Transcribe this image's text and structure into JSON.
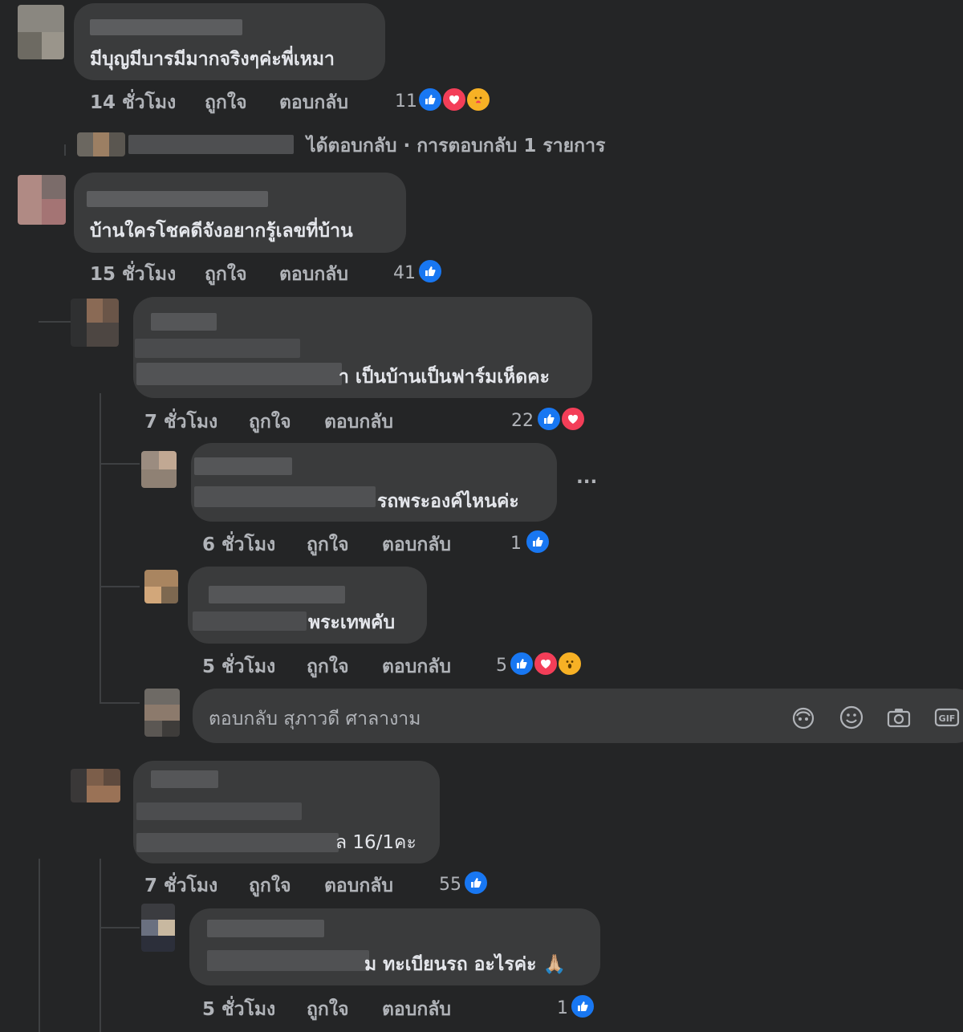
{
  "comments": [
    {
      "text": "มีบุญมีบารมีมากจริงๆค่ะพี่เหมา",
      "time": "14 ชั่วโมง",
      "like": "ถูกใจ",
      "reply": "ตอบกลับ",
      "reactions": "11"
    },
    {
      "text": "บ้านใครโชคดีจังอยากรู้เลขที่บ้าน",
      "time": "15 ชั่วโมง",
      "like": "ถูกใจ",
      "reply": "ตอบกลับ",
      "reactions": "41"
    },
    {
      "text": "า เป็นบ้านเป็นฟาร์มเห็ดคะ",
      "time": "7 ชั่วโมง",
      "like": "ถูกใจ",
      "reply": "ตอบกลับ",
      "reactions": "22"
    },
    {
      "text": "รถพระองค์ไหนค่ะ",
      "time": "6 ชั่วโมง",
      "like": "ถูกใจ",
      "reply": "ตอบกลับ",
      "reactions": "1"
    },
    {
      "text": "พระเทพคับ",
      "time": "5 ชั่วโมง",
      "like": "ถูกใจ",
      "reply": "ตอบกลับ",
      "reactions": "5"
    },
    {
      "text": "ล 16/1คะ",
      "time": "7 ชั่วโมง",
      "like": "ถูกใจ",
      "reply": "ตอบกลับ",
      "reactions": "55"
    },
    {
      "text": "ม ทะเบียนรถ อะไรค่ะ 🙏🏼",
      "time": "5 ชั่วโมง",
      "like": "ถูกใจ",
      "reply": "ตอบกลับ",
      "reactions": "1"
    }
  ],
  "replied_summary": "ได้ตอบกลับ · การตอบกลับ 1 รายการ",
  "more_options": "···",
  "reply_box": {
    "placeholder": "ตอบกลับ สุภาวดี ศาลางาม"
  },
  "icons": [
    "avatar-sticker-icon",
    "emoji-icon",
    "camera-icon",
    "gif-icon"
  ],
  "colors": {
    "background": "#242526",
    "bubble": "#3a3b3c",
    "like": "#1877f2",
    "love": "#f33e58",
    "haha": "#f7b125"
  }
}
